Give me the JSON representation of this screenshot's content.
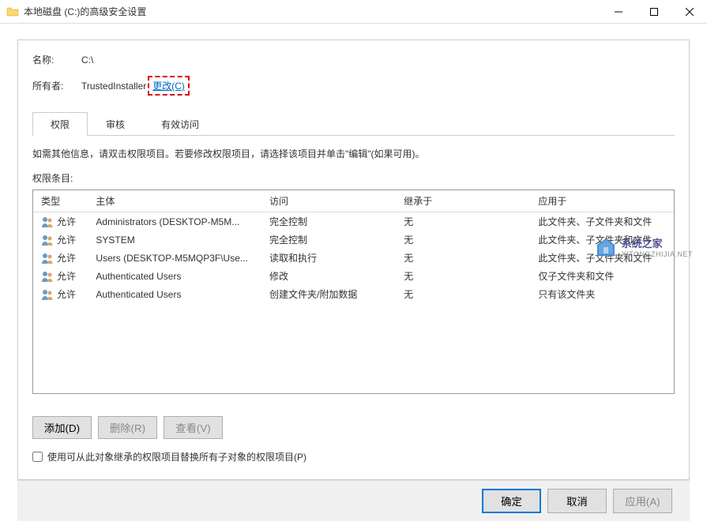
{
  "title": "本地磁盘 (C:)的高级安全设置",
  "name_label": "名称:",
  "name_value": "C:\\",
  "owner_label": "所有者:",
  "owner_value": "TrustedInstaller",
  "change_link": "更改(C)",
  "tabs": [
    {
      "label": "权限",
      "active": true
    },
    {
      "label": "审核",
      "active": false
    },
    {
      "label": "有效访问",
      "active": false
    }
  ],
  "info_text": "如需其他信息，请双击权限项目。若要修改权限项目，请选择该项目并单击\"编辑\"(如果可用)。",
  "perm_label": "权限条目:",
  "columns": {
    "type": "类型",
    "principal": "主体",
    "access": "访问",
    "inherit": "继承于",
    "apply": "应用于"
  },
  "rows": [
    {
      "type": "允许",
      "principal": "Administrators (DESKTOP-M5M...",
      "access": "完全控制",
      "inherit": "无",
      "apply": "此文件夹、子文件夹和文件"
    },
    {
      "type": "允许",
      "principal": "SYSTEM",
      "access": "完全控制",
      "inherit": "无",
      "apply": "此文件夹、子文件夹和文件"
    },
    {
      "type": "允许",
      "principal": "Users (DESKTOP-M5MQP3F\\Use...",
      "access": "读取和执行",
      "inherit": "无",
      "apply": "此文件夹、子文件夹和文件"
    },
    {
      "type": "允许",
      "principal": "Authenticated Users",
      "access": "修改",
      "inherit": "无",
      "apply": "仅子文件夹和文件"
    },
    {
      "type": "允许",
      "principal": "Authenticated Users",
      "access": "创建文件夹/附加数据",
      "inherit": "无",
      "apply": "只有该文件夹"
    }
  ],
  "buttons": {
    "add": "添加(D)",
    "remove": "删除(R)",
    "view": "查看(V)"
  },
  "replace_checkbox": "使用可从此对象继承的权限项目替换所有子对象的权限项目(P)",
  "footer": {
    "ok": "确定",
    "cancel": "取消",
    "apply": "应用(A)"
  },
  "watermark": {
    "title": "系统之家",
    "sub": "XITONGZHIJIA.NET"
  }
}
